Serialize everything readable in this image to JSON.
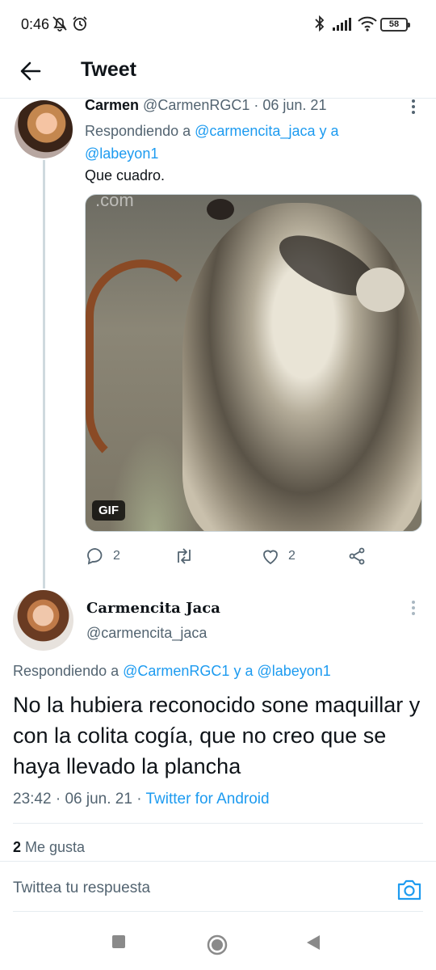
{
  "status_bar": {
    "time": "0:46",
    "battery": "58",
    "icons": [
      "mute-bell-icon",
      "alarm-icon",
      "bluetooth-icon",
      "signal-icon",
      "wifi-icon",
      "battery-icon"
    ]
  },
  "header": {
    "title": "Tweet",
    "back_icon": "arrow-left-icon"
  },
  "reply_tweet": {
    "name": "Carmen",
    "handle": "@CarmenRGC1",
    "separator": "·",
    "date": "06 jun. 21",
    "replying_prefix": "Respondiendo a",
    "replying_user1": "@carmencita_jaca",
    "replying_conj": "y a",
    "replying_user2": "@labeyon1",
    "text": "Que cuadro.",
    "media_watermark": ".com",
    "media_badge": "GIF",
    "actions": {
      "reply_count": "2",
      "retweet_count": "",
      "like_count": "2"
    }
  },
  "main_tweet": {
    "name": "Carmencita Jaca",
    "handle": "@carmencita_jaca",
    "replying_prefix": "Respondiendo a",
    "replying_user1": "@CarmenRGC1",
    "replying_conj": "y a",
    "replying_user2": "@labeyon1",
    "text": "No la hubiera reconocido sone maquillar y con la colita cogía, que no creo que se haya llevado la plancha",
    "time": "23:42",
    "separator": "·",
    "date": "06 jun. 21",
    "source": "Twitter for Android",
    "likes_count": "2",
    "likes_label": "Me gusta"
  },
  "composer": {
    "placeholder": "Twittea tu respuesta",
    "camera_icon": "camera-icon"
  },
  "colors": {
    "link": "#1d9bf0",
    "secondary_text": "#536471",
    "primary_text": "#0f1419",
    "divider": "#e6ecf0"
  }
}
